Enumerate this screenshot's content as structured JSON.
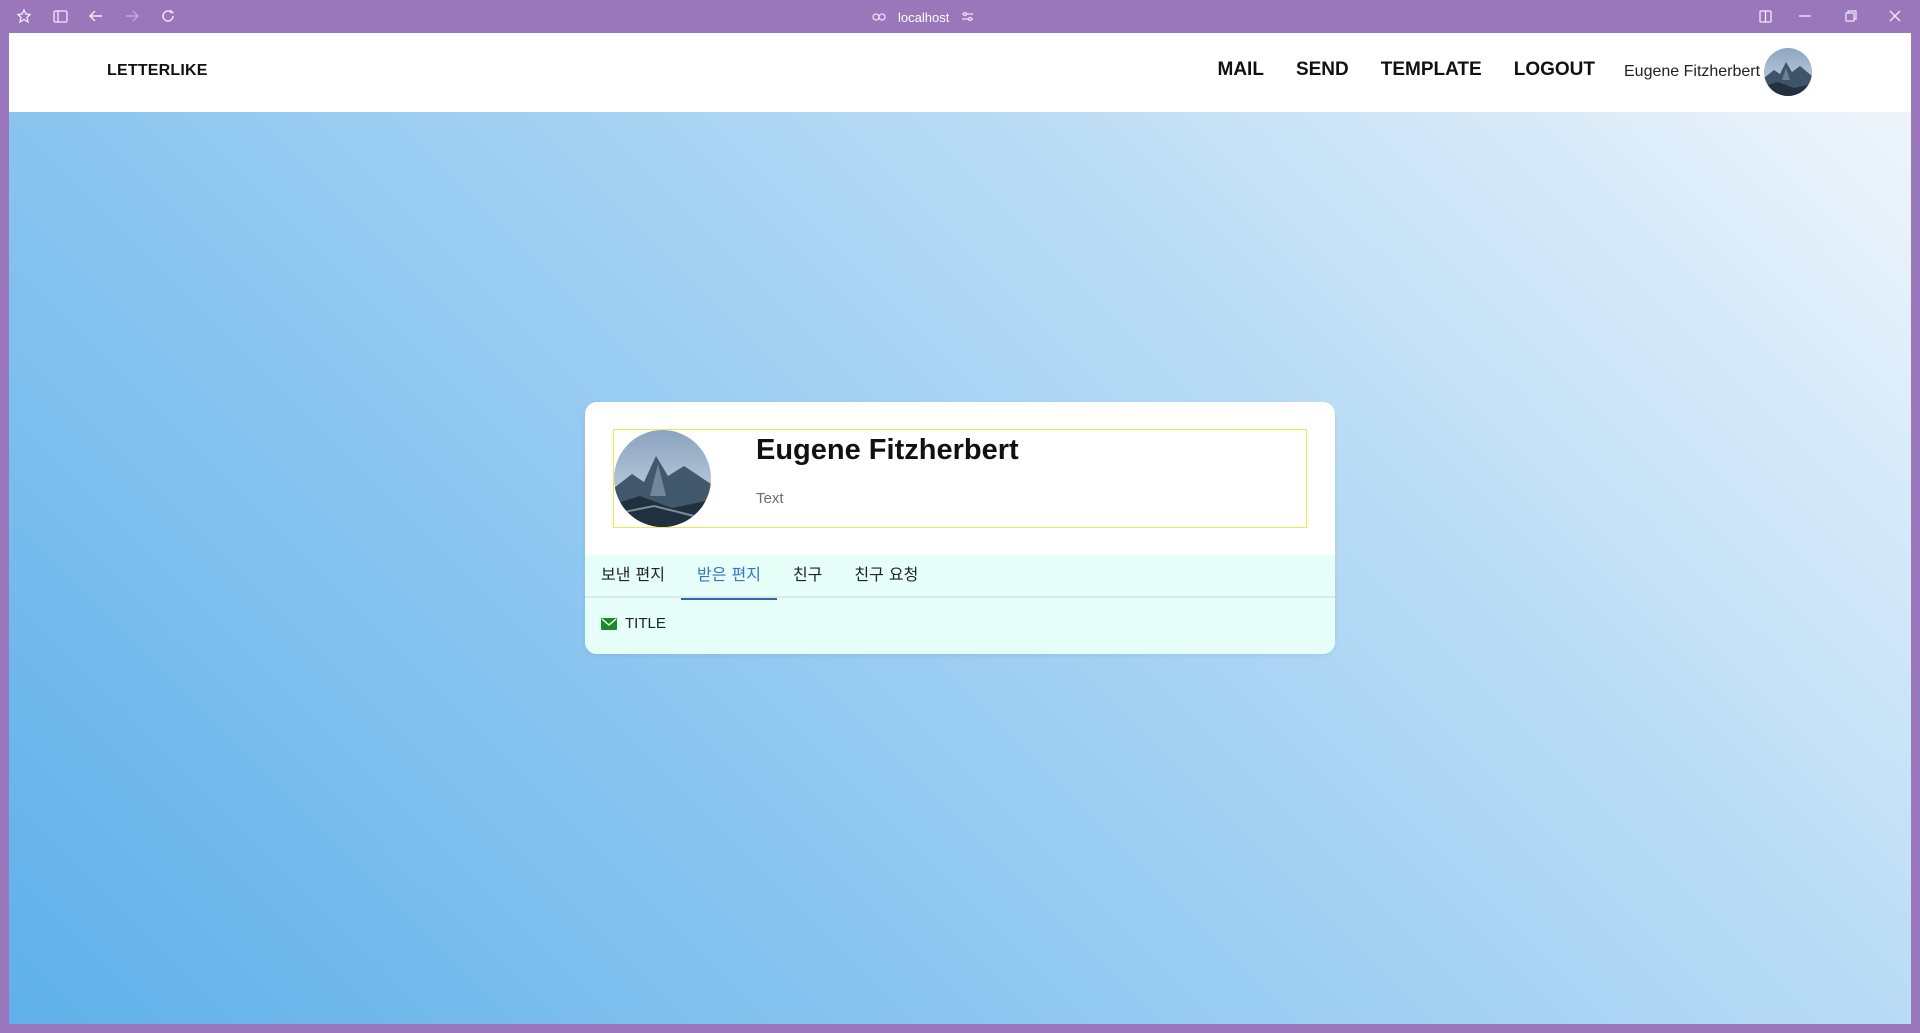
{
  "browser": {
    "url": "localhost"
  },
  "navbar": {
    "brand": "LETTERLIKE",
    "links": [
      "MAIL",
      "SEND",
      "TEMPLATE",
      "LOGOUT"
    ],
    "user_name": "Eugene Fitzherbert"
  },
  "profile": {
    "name": "Eugene Fitzherbert",
    "bio": "Text"
  },
  "tabs": [
    {
      "label": "보낸 편지",
      "active": false
    },
    {
      "label": "받은 편지",
      "active": true
    },
    {
      "label": "친구",
      "active": false
    },
    {
      "label": "친구 요청",
      "active": false
    }
  ],
  "mail_list": [
    {
      "title": "TITLE"
    }
  ],
  "colors": {
    "chrome": "#9a76bb",
    "accent": "#3a72c6",
    "tab_bg": "#e6fff8",
    "mail_icon": "#1a8a2a",
    "highlight_border": "#f1e94a"
  }
}
